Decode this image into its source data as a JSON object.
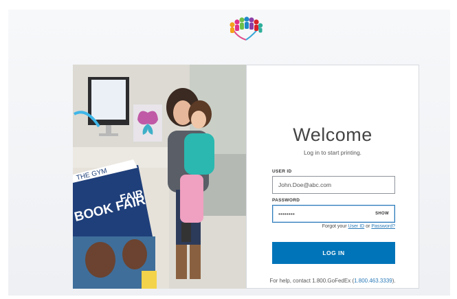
{
  "logo": {
    "icon": "colorful-people-logo"
  },
  "photo": {
    "description_icon": "mother-child-printing-photo",
    "signs": [
      "THE GYM",
      "BOOK FAIR",
      "FAIR"
    ]
  },
  "login": {
    "title": "Welcome",
    "subtitle": "Log in to start printing.",
    "user_id_label": "USER ID",
    "user_id_value": "John.Doe@abc.com",
    "password_label": "PASSWORD",
    "password_value": "••••••••",
    "show_label": "SHOW",
    "forgot_prefix": "Forgot your",
    "forgot_user_id": "User ID",
    "forgot_or": "or",
    "forgot_password": "Password?",
    "login_button": "LOG IN",
    "help_prefix": "For help, contact 1.800.GoFedEx (",
    "help_phone": "1.800.463.3339",
    "help_suffix": ")."
  },
  "colors": {
    "accent": "#0074b8",
    "link": "#2a7ab8",
    "background": "#f2f4f6"
  }
}
